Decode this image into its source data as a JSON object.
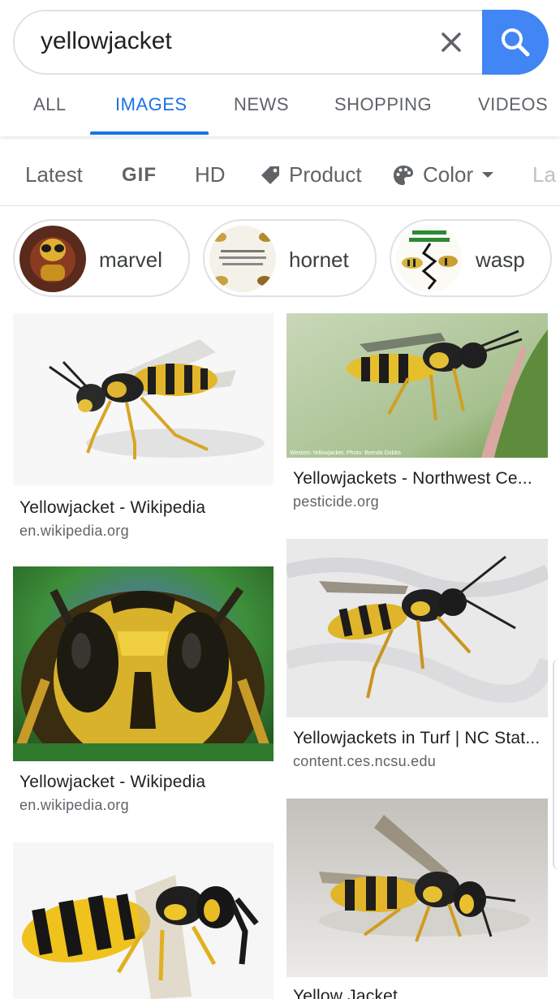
{
  "search": {
    "query": "yellowjacket"
  },
  "tabs": [
    {
      "label": "ALL"
    },
    {
      "label": "IMAGES"
    },
    {
      "label": "NEWS"
    },
    {
      "label": "SHOPPING"
    },
    {
      "label": "VIDEOS"
    }
  ],
  "filters": {
    "latest": "Latest",
    "gif": "GIF",
    "hd": "HD",
    "product": "Product",
    "color": "Color",
    "partial": "La"
  },
  "chips": [
    {
      "label": "marvel"
    },
    {
      "label": "hornet"
    },
    {
      "label": "wasp"
    }
  ],
  "results": [
    {
      "title": "Yellowjacket - Wikipedia",
      "source": "en.wikipedia.org"
    },
    {
      "title": "Yellowjackets - Northwest Ce...",
      "source": "pesticide.org"
    },
    {
      "title": "Yellowjacket - Wikipedia",
      "source": "en.wikipedia.org"
    },
    {
      "title": "Yellowjackets in Turf | NC Stat...",
      "source": "content.ces.ncsu.edu"
    },
    {
      "title": "",
      "source": ""
    },
    {
      "title": "Yellow Jacket",
      "source": ""
    }
  ],
  "colors": {
    "accent": "#1a73e8",
    "search_button": "#4285f4",
    "muted": "#5f6368"
  }
}
